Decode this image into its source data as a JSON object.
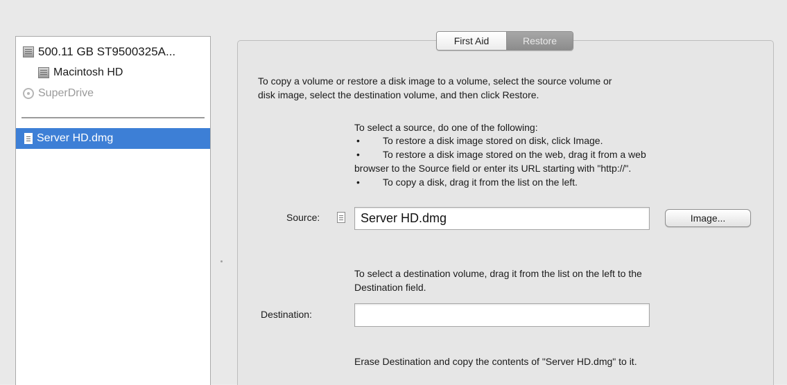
{
  "sidebar": {
    "items": [
      {
        "label": "500.11 GB ST9500325A...",
        "icon": "disk-icon"
      },
      {
        "label": "Macintosh HD",
        "icon": "disk-icon"
      },
      {
        "label": "SuperDrive",
        "icon": "optical-drive-icon"
      }
    ],
    "selected_item": {
      "label": "Server HD.dmg",
      "icon": "disk-image-icon"
    }
  },
  "tabs": [
    {
      "label": "First Aid",
      "active": false
    },
    {
      "label": "Restore",
      "active": true
    }
  ],
  "restore": {
    "intro_line1": "To copy a volume or restore a disk image to a volume, select the source volume or",
    "intro_line2": "disk image, select the destination volume, and then click Restore.",
    "source_heading": "To select a source, do one of the following:",
    "bullet1": "To restore a disk image stored on disk, click Image.",
    "bullet2_line1": "To restore a disk image stored on the web, drag it from a web",
    "bullet2_line2": "browser to the Source field or enter its URL starting with \"http://\".",
    "bullet3": "To copy a disk, drag it from the list on the left.",
    "bullet_glyph": "•",
    "source_label": "Source:",
    "source_value": "Server HD.dmg",
    "image_button": "Image...",
    "dest_instruction_line1": "To select a destination volume, drag it from the list on the left to the",
    "dest_instruction_line2": "Destination field.",
    "destination_label": "Destination:",
    "destination_value": "",
    "erase_note": "Erase Destination and copy the contents of \"Server HD.dmg\" to it."
  },
  "colors": {
    "selection": "#3d7fd6",
    "active_tab": "#9a9a9a",
    "window_bg": "#e9e9e9"
  }
}
